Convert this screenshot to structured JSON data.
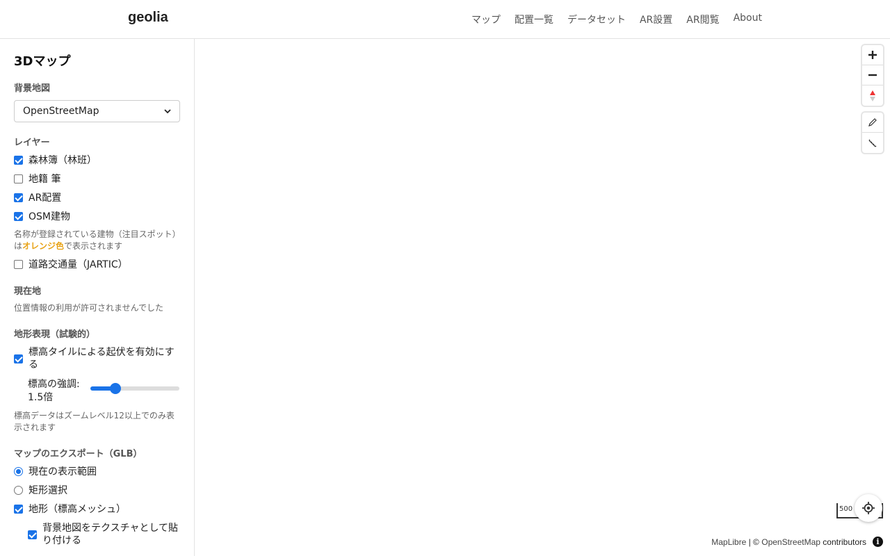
{
  "header": {
    "brand": "geolia",
    "nav": [
      "マップ",
      "配置一覧",
      "データセット",
      "AR設置",
      "AR閲覧",
      "About"
    ]
  },
  "sidebar": {
    "title": "3Dマップ",
    "basemap": {
      "label": "背景地図",
      "selected": "OpenStreetMap"
    },
    "layers": {
      "label": "レイヤー",
      "items": [
        {
          "label": "森林簿（林班）",
          "checked": true
        },
        {
          "label": "地籍 筆",
          "checked": false
        },
        {
          "label": "AR配置",
          "checked": true
        },
        {
          "label": "OSM建物",
          "checked": true
        }
      ],
      "note_prefix": "名称が登録されている建物（注目スポット）は",
      "note_highlight": "オレンジ色",
      "note_suffix": "で表示されます",
      "traffic": {
        "label": "道路交通量（JARTIC）",
        "checked": false
      }
    },
    "location": {
      "label": "現在地",
      "status": "位置情報の利用が許可されませんでした"
    },
    "terrain": {
      "label": "地形表現（試験的）",
      "enable": {
        "label": "標高タイルによる起伏を有効にする",
        "checked": true
      },
      "exaggeration_label": "標高の強調: 1.5倍",
      "exaggeration_fraction": 0.28,
      "note": "標高データはズームレベル12以上でのみ表示されます"
    },
    "export": {
      "label": "マップのエクスポート（GLB）",
      "range_options": [
        {
          "label": "現在の表示範囲",
          "selected": true
        },
        {
          "label": "矩形選択",
          "selected": false
        }
      ],
      "terrain_mesh": {
        "label": "地形（標高メッシュ）",
        "checked": true
      },
      "texture": {
        "label": "背景地図をテクスチャとして貼り付ける",
        "checked": true
      }
    }
  },
  "map": {
    "scale_label": "500",
    "attribution": {
      "maplibre": "MapLibre",
      "sep": "| ©",
      "osm": "OpenStreetMap",
      "contributors": "contributors",
      "info": "i"
    },
    "accent": "#1a73e8"
  }
}
